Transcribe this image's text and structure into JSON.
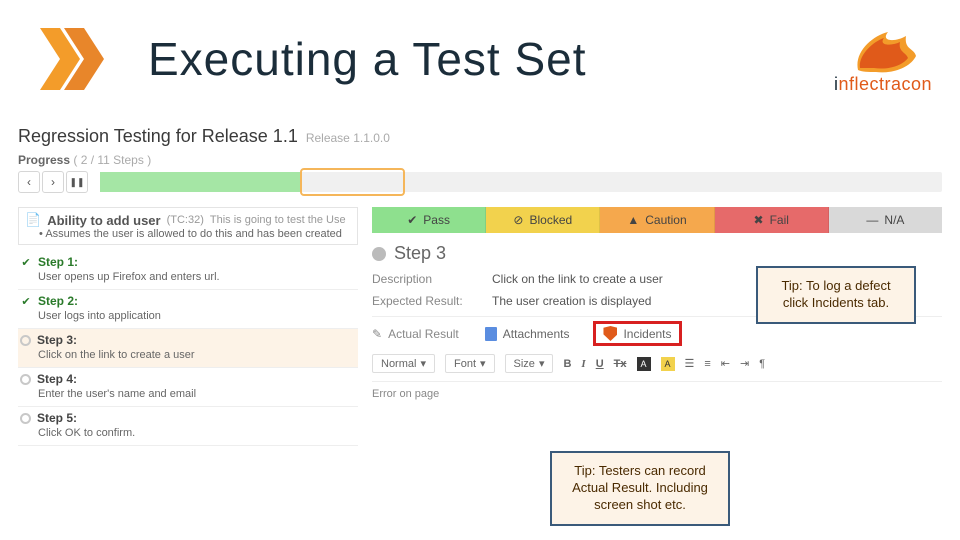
{
  "slide": {
    "title": "Executing a Test Set",
    "brand": "nflectracon"
  },
  "screenshot": {
    "regression": {
      "label": "Regression Testing for Release 1.1",
      "release": "Release 1.1.0.0"
    },
    "progress": {
      "label": "Progress",
      "counter": "( 2 / 11 Steps )",
      "percent": 24,
      "current_start": 24,
      "current_end": 36
    },
    "nav": {
      "prev": "‹",
      "next": "›",
      "pause": "❚❚"
    },
    "testcase": {
      "title": "Ability to add user",
      "id": "(TC:32)",
      "preview": "This is going to test the Use",
      "assume_bullet": "• ",
      "assume": "Assumes the user is allowed to do this and has been created"
    },
    "steps": [
      {
        "label": "Step 1:",
        "desc": "User opens up Firefox and enters url.",
        "state": "done"
      },
      {
        "label": "Step 2:",
        "desc": "User logs into application",
        "state": "done"
      },
      {
        "label": "Step 3:",
        "desc": "Click on the link to create a user",
        "state": "active"
      },
      {
        "label": "Step 4:",
        "desc": "Enter the user's name and email",
        "state": "open"
      },
      {
        "label": "Step 5:",
        "desc": "Click OK to confirm.",
        "state": "open"
      }
    ],
    "status": {
      "pass": "Pass",
      "blocked": "Blocked",
      "caution": "Caution",
      "fail": "Fail",
      "na": "N/A"
    },
    "step3": {
      "title": "Step 3",
      "desc_label": "Description",
      "desc_value": "Click on the link to create a user",
      "exp_label": "Expected Result:",
      "exp_value": "The user creation is displayed"
    },
    "result_tabs": {
      "actual": "Actual Result",
      "attachments": "Attachments",
      "incidents": "Incidents"
    },
    "toolbar": {
      "normal": "Normal",
      "font": "Font",
      "size": "Size",
      "b": "B",
      "i": "I",
      "u": "U",
      "s": "Tx",
      "a": "A"
    },
    "error": "Error on page"
  },
  "tips": {
    "log_defect": "Tip: To log a defect click Incidents tab.",
    "actual_result": "Tip:  Testers can record Actual Result.  Including screen shot etc."
  }
}
